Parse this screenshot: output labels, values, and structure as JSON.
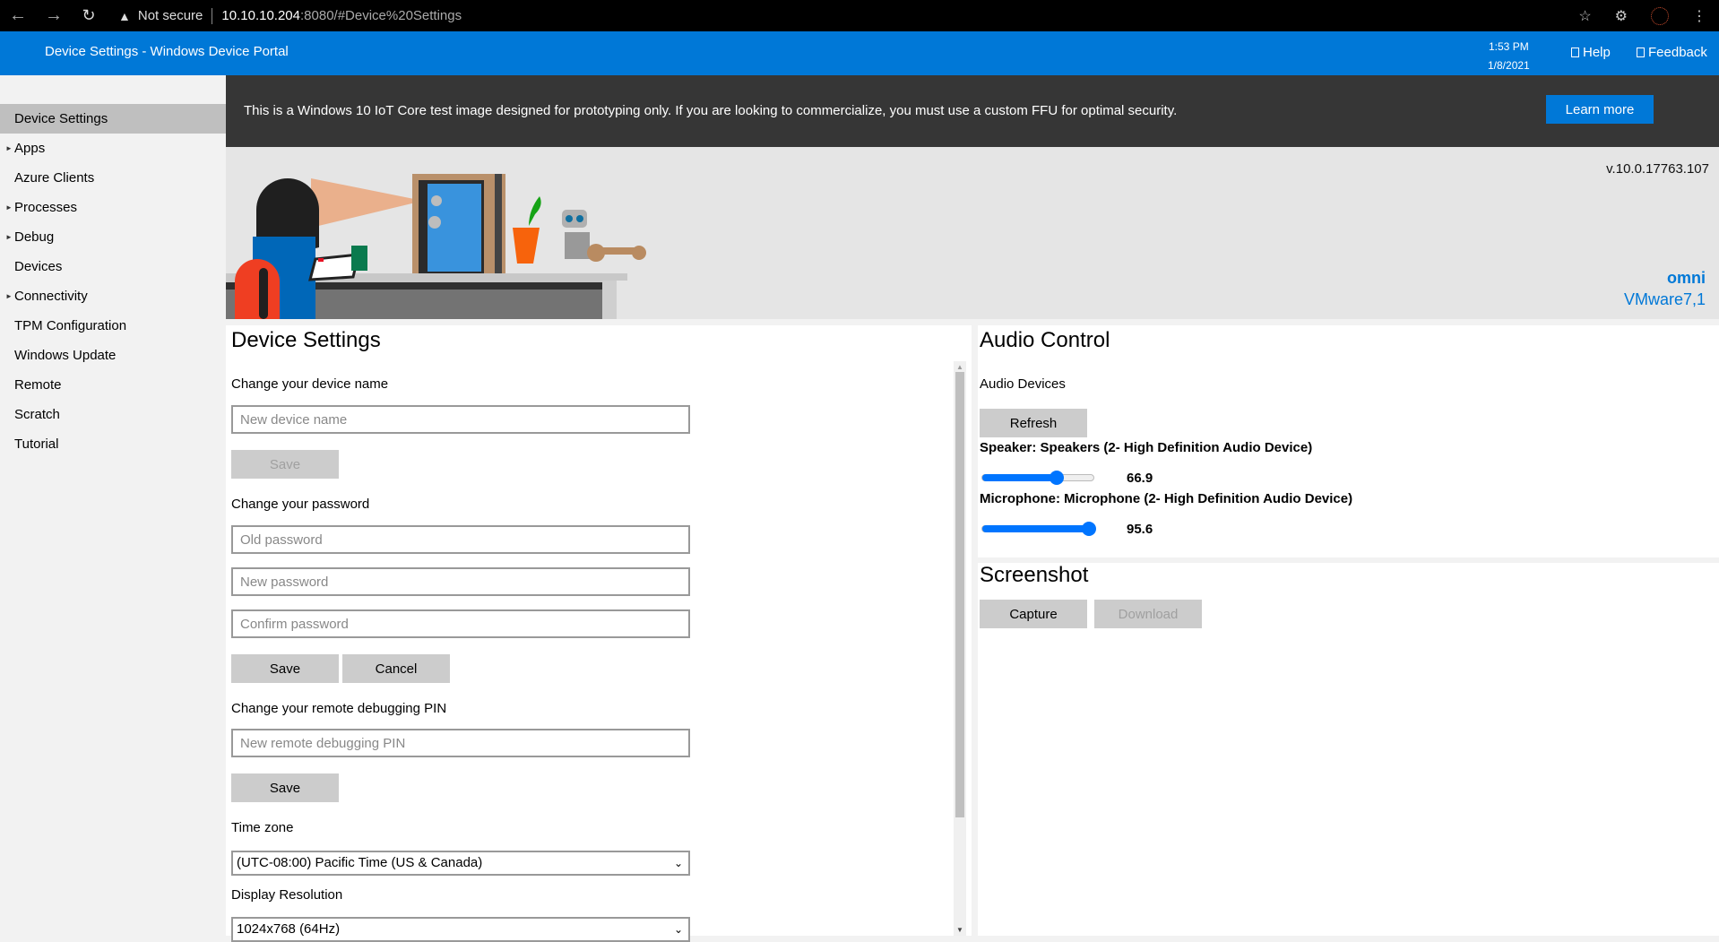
{
  "browser": {
    "not_secure": "Not secure",
    "url_host": "10.10.10.204",
    "url_rest": ":8080/#Device%20Settings"
  },
  "header": {
    "title": "Device Settings - Windows Device Portal",
    "time": "1:53 PM",
    "date": "1/8/2021",
    "help": "Help",
    "feedback": "Feedback",
    "accent": "#0078d7"
  },
  "sidebar": {
    "items": [
      {
        "label": "Device Settings",
        "expandable": false,
        "active": true
      },
      {
        "label": "Apps",
        "expandable": true
      },
      {
        "label": "Azure Clients",
        "expandable": false
      },
      {
        "label": "Processes",
        "expandable": true
      },
      {
        "label": "Debug",
        "expandable": true
      },
      {
        "label": "Devices",
        "expandable": false
      },
      {
        "label": "Connectivity",
        "expandable": true
      },
      {
        "label": "TPM Configuration",
        "expandable": false
      },
      {
        "label": "Windows Update",
        "expandable": false
      },
      {
        "label": "Remote",
        "expandable": false
      },
      {
        "label": "Scratch",
        "expandable": false
      },
      {
        "label": "Tutorial",
        "expandable": false
      }
    ]
  },
  "banner": {
    "message": "This is a Windows 10 IoT Core test image designed for prototyping only. If you are looking to commercialize, you must use a custom FFU for optimal security.",
    "learn_more": "Learn more"
  },
  "hero": {
    "version": "v.10.0.17763.107",
    "device_name": "omni",
    "model": "VMware7,1"
  },
  "device_settings": {
    "title": "Device Settings",
    "device_name_label": "Change your device name",
    "device_name_placeholder": "New device name",
    "save": "Save",
    "password_label": "Change your password",
    "old_password_placeholder": "Old password",
    "new_password_placeholder": "New password",
    "confirm_password_placeholder": "Confirm password",
    "cancel": "Cancel",
    "pin_label": "Change your remote debugging PIN",
    "pin_placeholder": "New remote debugging PIN",
    "timezone_label": "Time zone",
    "timezone_value": "(UTC-08:00) Pacific Time (US & Canada)",
    "resolution_label": "Display Resolution",
    "resolution_value": "1024x768 (64Hz)"
  },
  "audio": {
    "title": "Audio Control",
    "devices_label": "Audio Devices",
    "refresh": "Refresh",
    "speaker_label": "Speaker: Speakers (2- High Definition Audio Device)",
    "speaker_value": "66.9",
    "speaker_level": 66.9,
    "mic_label": "Microphone: Microphone (2- High Definition Audio Device)",
    "mic_value": "95.6",
    "mic_level": 95.6
  },
  "screenshot": {
    "title": "Screenshot",
    "capture": "Capture",
    "download": "Download"
  }
}
